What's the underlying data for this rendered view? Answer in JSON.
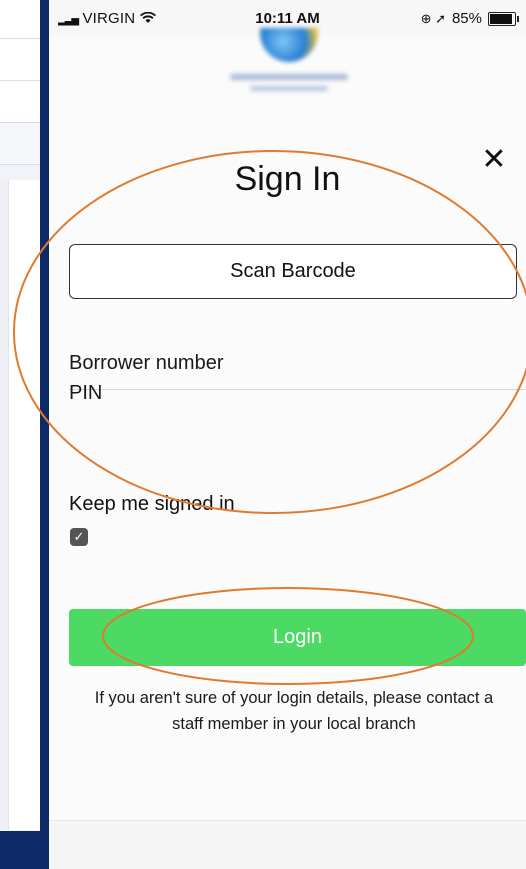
{
  "status_bar": {
    "carrier": "VIRGIN",
    "time": "10:11 AM",
    "battery": "85%"
  },
  "dialog": {
    "title": "Sign In",
    "scan_button": "Scan Barcode",
    "borrower_placeholder": "Borrower number",
    "pin_placeholder": "PIN",
    "keep_signed_in_label": "Keep me signed in",
    "keep_signed_in_checked": true,
    "login_button": "Login",
    "help_text": "If you aren't sure of your login details, please contact a staff member in your local branch"
  },
  "colors": {
    "background_navy": "#0d2a66",
    "login_green": "#4cd964",
    "annotation_orange": "#e07a2f"
  },
  "icons": [
    "wifi-icon",
    "signal-icon",
    "location-icon",
    "battery-icon",
    "close-icon",
    "checkbox-icon"
  ]
}
